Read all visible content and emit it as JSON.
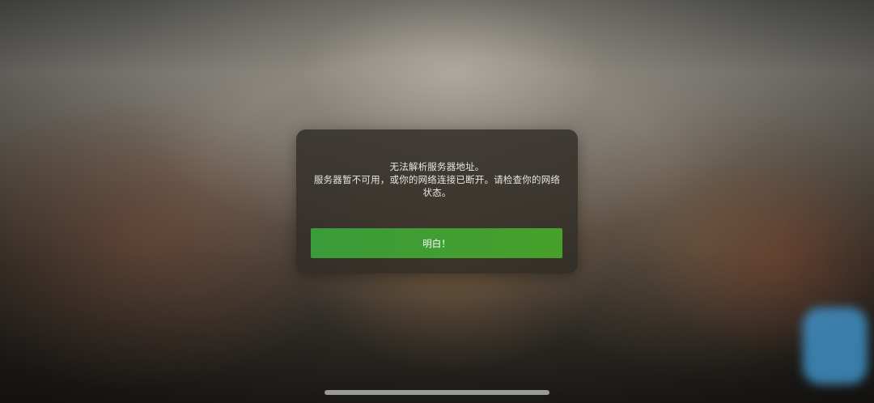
{
  "dialog": {
    "message_lines": [
      "无法解析服务器地址。",
      "服务器暂不可用，或你的网络连接已断开。请检查你的网络",
      "状态。"
    ],
    "button_label": "明白！"
  },
  "colors": {
    "button_green": "#3a9b3a",
    "dialog_bg": "#302c26",
    "side_blob": "#3f8fc4"
  }
}
